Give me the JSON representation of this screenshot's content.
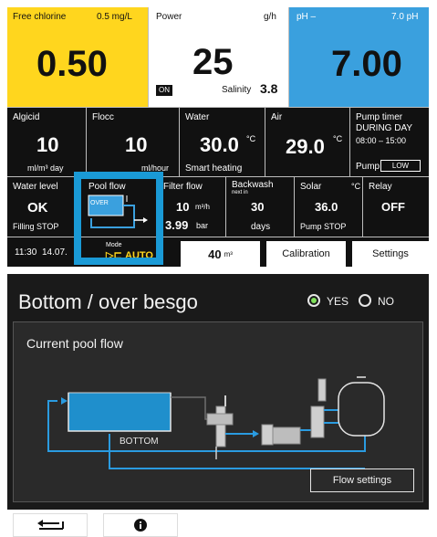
{
  "top": {
    "free_chlorine": {
      "label": "Free chlorine",
      "unit": "0.5 mg/L",
      "value": "0.50"
    },
    "power": {
      "label": "Power",
      "unit": "g/h",
      "value": "25",
      "state": "ON",
      "salinity_label": "Salinity",
      "salinity_value": "3.8"
    },
    "ph": {
      "label": "pH –",
      "target": "7.0 pH",
      "value": "7.00"
    },
    "algicid": {
      "label": "Algicid",
      "value": "10",
      "unit": "ml/m³ day"
    },
    "flocc": {
      "label": "Flocc",
      "value": "10",
      "unit": "ml/hour"
    },
    "water": {
      "label": "Water",
      "value": "30.0",
      "unit": "°C",
      "sub": "Smart heating"
    },
    "air": {
      "label": "Air",
      "value": "29.0",
      "unit": "°C"
    },
    "pump_timer": {
      "label": "Pump timer",
      "line1": "DURING DAY",
      "line2": "08:00 – 15:00",
      "pump_label": "Pump",
      "pump_value": "LOW"
    },
    "water_level": {
      "label": "Water level",
      "value": "OK",
      "sub": "Filling STOP"
    },
    "pool_flow": {
      "label": "Pool flow",
      "badge": "OVER"
    },
    "filter_flow": {
      "label": "Filter flow",
      "value": "10",
      "unit": "m³/h",
      "value2": "3.99",
      "unit2": "bar"
    },
    "backwash": {
      "label": "Backwash",
      "sub": "next in",
      "value": "30",
      "unit": "days"
    },
    "solar": {
      "label": "Solar",
      "unit": "°C",
      "value": "36.0",
      "sub": "Pump STOP"
    },
    "relay": {
      "label": "Relay",
      "value": "OFF"
    },
    "status": {
      "time": "11:30",
      "date": "14.07.",
      "mode_label": "Mode",
      "mode_value": "AUTO"
    },
    "volume": {
      "value": "40",
      "unit": "m³"
    },
    "calibration_label": "Calibration",
    "settings_label": "Settings"
  },
  "bottom": {
    "title": "Bottom / over besgo",
    "yes_label": "YES",
    "no_label": "NO",
    "panel_title": "Current pool flow",
    "diagram_label": "BOTTOM",
    "flow_settings_label": "Flow settings"
  },
  "icons": {
    "back": "back-arrow-icon",
    "info": "info-icon"
  },
  "colors": {
    "yellow": "#ffd61e",
    "blue": "#3aa0de",
    "highlight": "#1a9ad6",
    "green": "#7fe05a",
    "pipe_blue": "#2a9be0"
  }
}
